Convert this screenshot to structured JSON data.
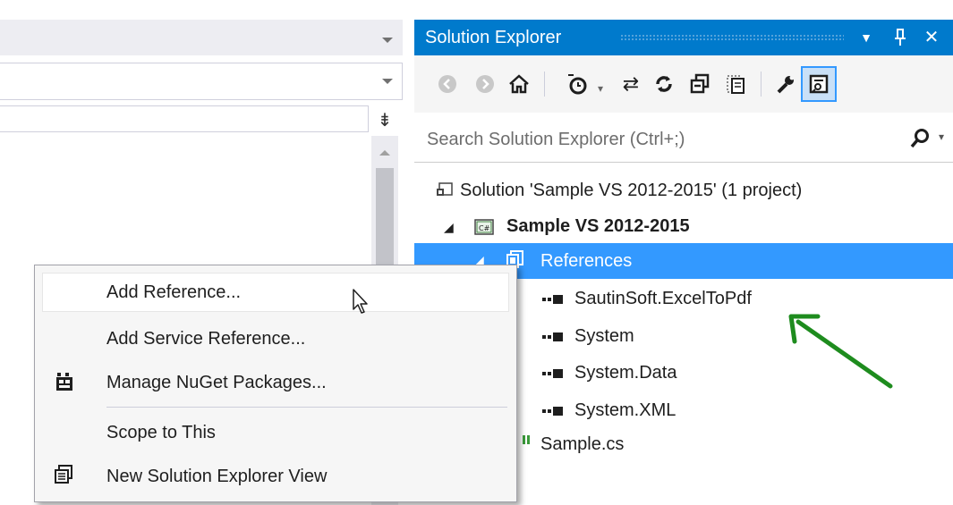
{
  "left_panel": {
    "dropdown_icon": "chevron-down-icon",
    "split_icon": "splitter-icon"
  },
  "solution_explorer": {
    "title": "Solution Explorer",
    "title_buttons": {
      "dropdown": "▼",
      "pin": "ꟼ",
      "close": "✕"
    },
    "toolbar_icons": [
      "back-icon",
      "forward-icon",
      "home-icon",
      "pending-changes-filter-icon",
      "sync-icon",
      "refresh-icon",
      "collapse-all-icon",
      "show-all-files-icon",
      "properties-icon",
      "preview-selected-icon"
    ],
    "search": {
      "placeholder": "Search Solution Explorer (Ctrl+;)"
    },
    "tree": {
      "solution": "Solution 'Sample VS 2012-2015' (1 project)",
      "project": "Sample VS 2012-2015",
      "references": "References",
      "refs": [
        "SautinSoft.ExcelToPdf",
        "System",
        "System.Data",
        "System.XML"
      ],
      "file": "Sample.cs"
    },
    "accent_color": "#007acc",
    "selection_color": "#3399ff",
    "arrow_color": "#1e8c1e"
  },
  "context_menu": {
    "items": [
      {
        "label": "Add Reference...",
        "icon": ""
      },
      {
        "label": "Add Service Reference...",
        "icon": ""
      },
      {
        "label": "Manage NuGet Packages...",
        "icon": "nuget-icon"
      },
      {
        "label": "Scope to This",
        "icon": ""
      },
      {
        "label": "New Solution Explorer View",
        "icon": "new-view-icon"
      }
    ]
  }
}
